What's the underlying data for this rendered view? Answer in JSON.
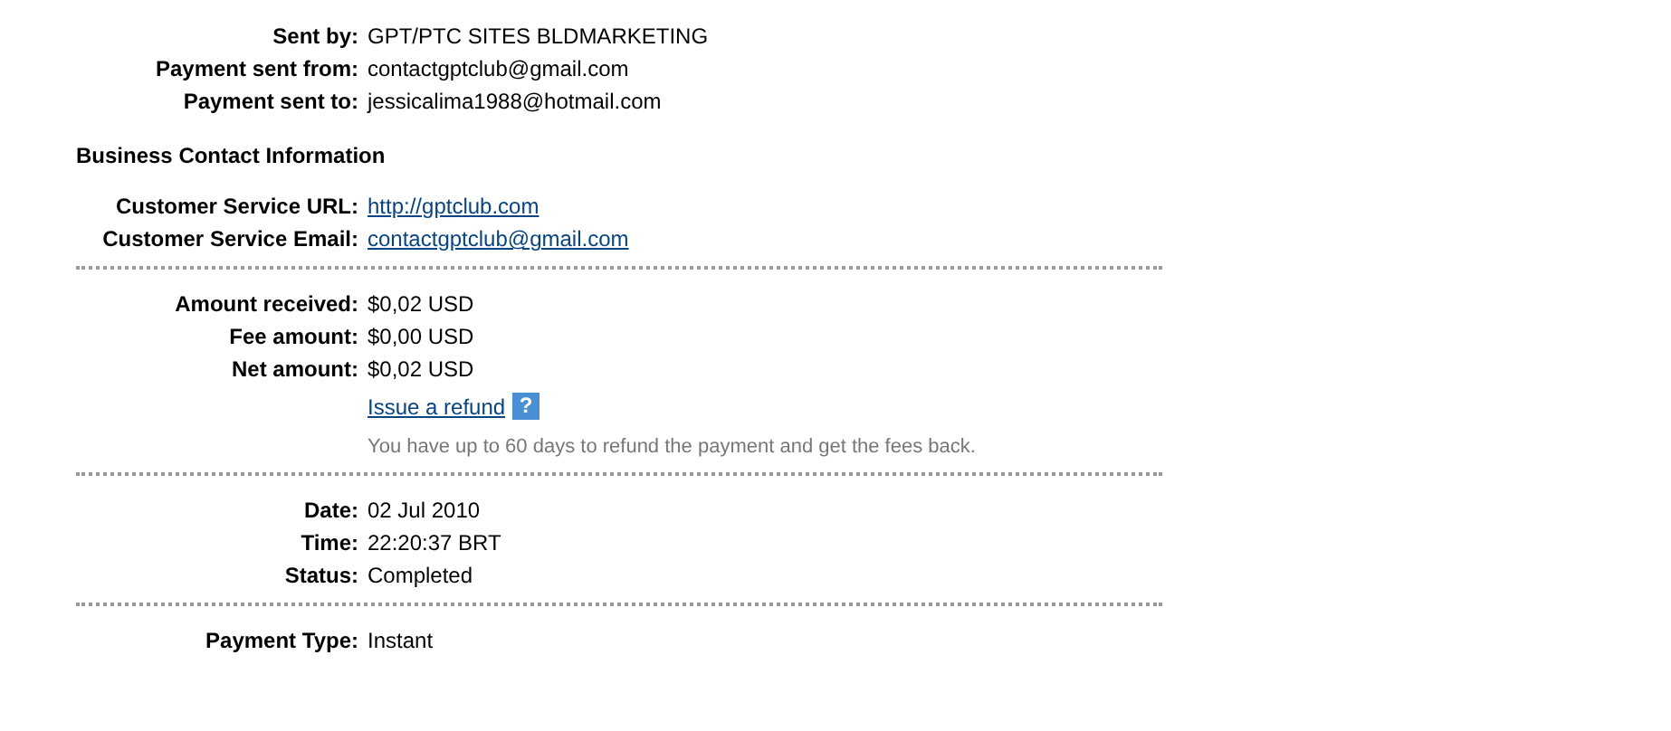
{
  "blocks": [
    {
      "kind": "fields",
      "rows": [
        {
          "label": "Sent by:",
          "value": "GPT/PTC SITES BLDMARKETING",
          "kind": "text"
        },
        {
          "label": "Payment sent from:",
          "value": "contactgptclub@gmail.com",
          "kind": "text"
        },
        {
          "label": "Payment sent to:",
          "value": "jessicalima1988@hotmail.com",
          "kind": "text"
        }
      ]
    },
    {
      "kind": "heading",
      "text": "Business Contact Information"
    },
    {
      "kind": "fields",
      "rows": [
        {
          "label": "Customer Service URL:",
          "value": "http://gptclub.com",
          "kind": "link"
        },
        {
          "label": "Customer Service Email:",
          "value": "contactgptclub@gmail.com",
          "kind": "link"
        }
      ]
    },
    {
      "kind": "divider"
    },
    {
      "kind": "fields",
      "rows": [
        {
          "label": "Amount received:",
          "value": "$0,02 USD",
          "kind": "text"
        },
        {
          "label": "Fee amount:",
          "value": "$0,00 USD",
          "kind": "text"
        },
        {
          "label": "Net amount:",
          "value": "$0,02 USD",
          "kind": "text"
        }
      ]
    },
    {
      "kind": "refund",
      "link": "Issue a refund",
      "help": "?",
      "note": "You have up to 60 days to refund the payment and get the fees back."
    },
    {
      "kind": "divider"
    },
    {
      "kind": "fields",
      "rows": [
        {
          "label": "Date:",
          "value": "02 Jul 2010",
          "kind": "text"
        },
        {
          "label": "Time:",
          "value": "22:20:37 BRT",
          "kind": "text"
        },
        {
          "label": "Status:",
          "value": "Completed",
          "kind": "text"
        }
      ]
    },
    {
      "kind": "divider"
    },
    {
      "kind": "fields",
      "rows": [
        {
          "label": "Payment Type:",
          "value": "Instant",
          "kind": "text"
        }
      ]
    }
  ]
}
